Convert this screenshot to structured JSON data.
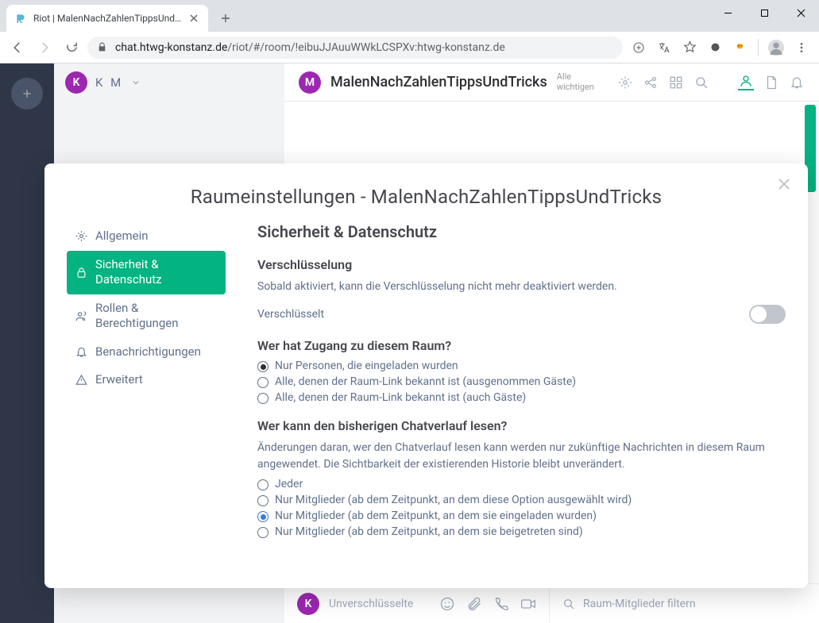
{
  "browser": {
    "tab_title": "Riot | MalenNachZahlenTippsUnd…",
    "url_host": "chat.htwg-konstanz.de",
    "url_path": "/riot/#/room/!eibuJJAuuWWkLCSPXv:htwg-konstanz.de"
  },
  "riot": {
    "user_initial": "K",
    "user_label": "K M",
    "room_initial": "M",
    "room_name": "MalenNachZahlenTippsUndTricks",
    "room_sub1": "Alle",
    "room_sub2": "wichtigen",
    "composer_placeholder": "Unverschlüsselte",
    "members_filter_placeholder": "Raum-Mitglieder filtern"
  },
  "modal": {
    "title": "Raumeinstellungen - MalenNachZahlenTippsUndTricks",
    "nav": {
      "general": "Allgemein",
      "security": "Sicherheit & Datenschutz",
      "roles": "Rollen & Berechtigungen",
      "notifications": "Benachrichtigungen",
      "advanced": "Erweitert"
    },
    "content": {
      "heading": "Sicherheit & Datenschutz",
      "encryption_heading": "Verschlüsselung",
      "encryption_note": "Sobald aktiviert, kann die Verschlüsselung nicht mehr deaktiviert werden.",
      "encryption_toggle_label": "Verschlüsselt",
      "access_heading": "Wer hat Zugang zu diesem Raum?",
      "access_options": [
        "Nur Personen, die eingeladen wurden",
        "Alle, denen der Raum-Link bekannt ist (ausgenommen Gäste)",
        "Alle, denen der Raum-Link bekannt ist (auch Gäste)"
      ],
      "history_heading": "Wer kann den bisherigen Chatverlauf lesen?",
      "history_note": "Änderungen daran, wer den Chatverlauf lesen kann werden nur zukünftige Nachrichten in diesem Raum angewendet. Die Sichtbarkeit der existierenden Historie bleibt unverändert.",
      "history_options": [
        "Jeder",
        "Nur Mitglieder (ab dem Zeitpunkt, an dem diese Option ausgewählt wird)",
        "Nur Mitglieder (ab dem Zeitpunkt, an dem sie eingeladen wurden)",
        "Nur Mitglieder (ab dem Zeitpunkt, an dem sie beigetreten sind)"
      ]
    }
  }
}
